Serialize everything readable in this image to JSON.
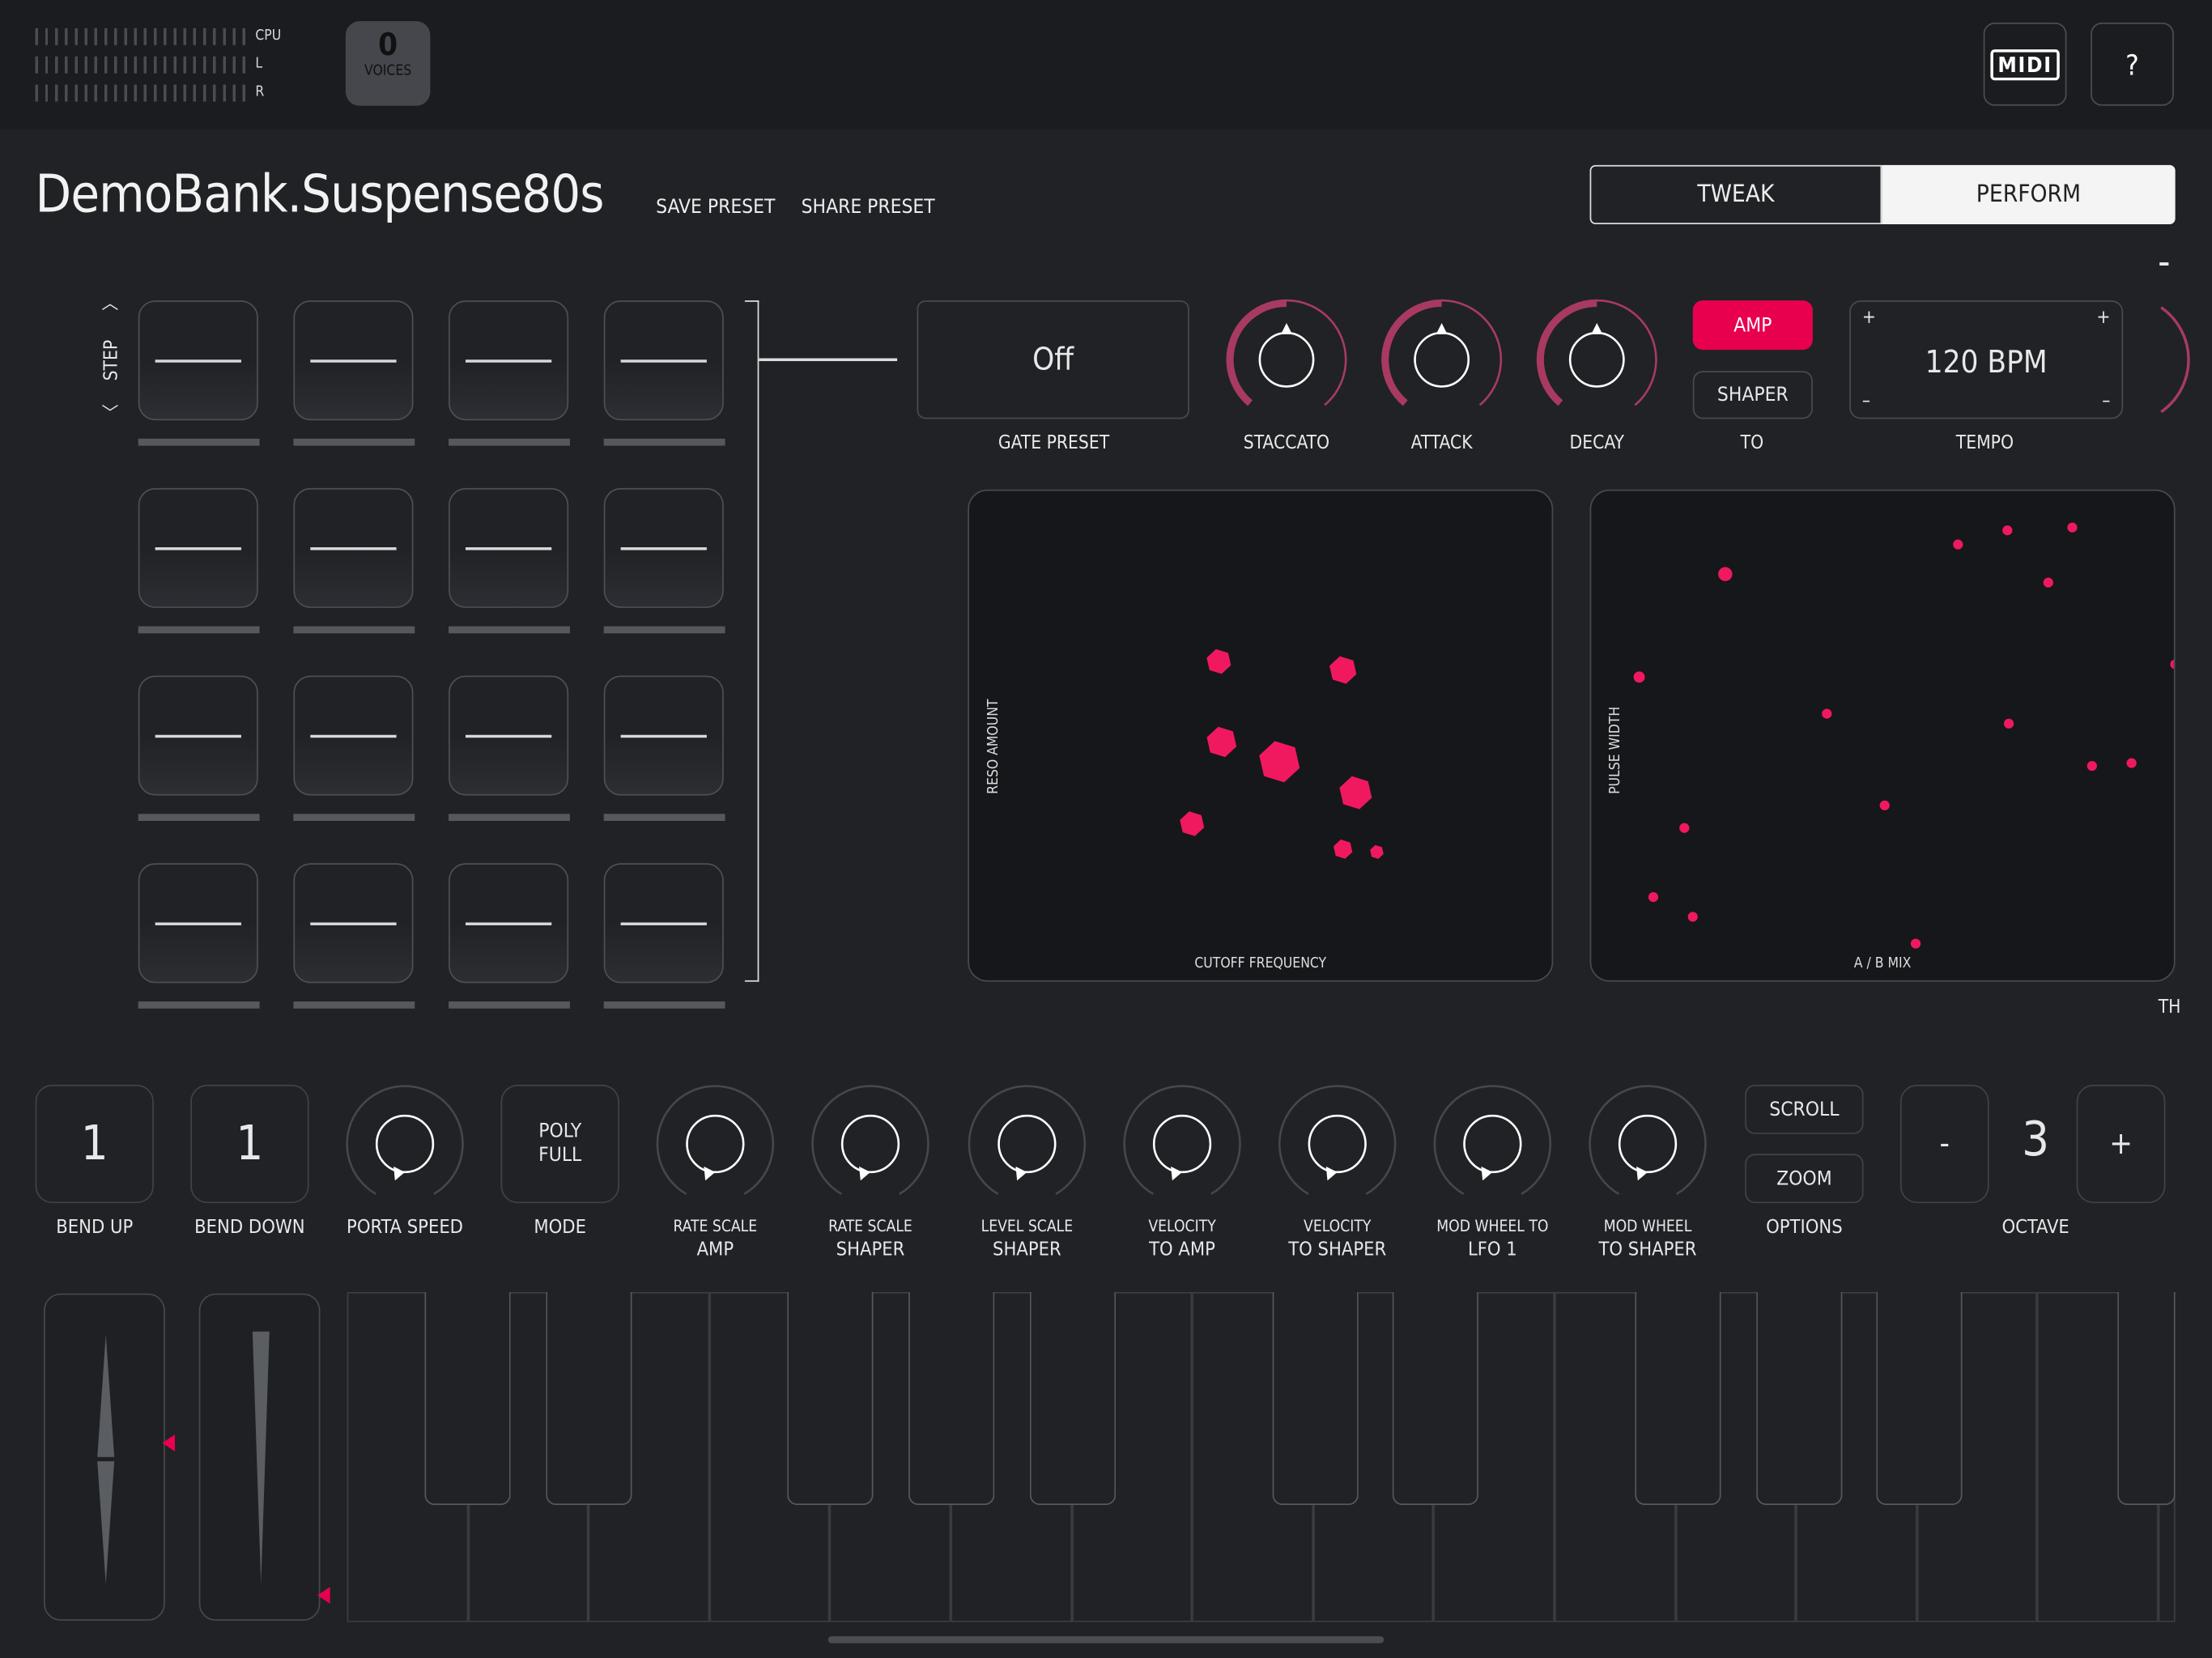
{
  "colors": {
    "accent": "#e8004f",
    "knob_arc": "#a83a62",
    "background": "#202226"
  },
  "top_bar": {
    "meters": [
      {
        "label": "CPU"
      },
      {
        "label": "L"
      },
      {
        "label": "R"
      }
    ],
    "voices": {
      "count": "0",
      "label": "VOICES"
    },
    "midi_button": {
      "label": "MIDI",
      "icon": "midi-icon"
    },
    "help_button": {
      "label": "?",
      "icon": "help-icon"
    }
  },
  "header": {
    "preset_name": "DemoBank.Suspense80s",
    "save_label": "SAVE PRESET",
    "share_label": "SHARE PRESET",
    "tabs": [
      {
        "label": "TWEAK",
        "active": false
      },
      {
        "label": "PERFORM",
        "active": true
      }
    ],
    "collapse_label": "–"
  },
  "sequencer": {
    "label": "STEP",
    "up_icon": "chevron-up-icon",
    "down_icon": "chevron-down-icon",
    "steps": 16
  },
  "gate": {
    "value": "Off",
    "label": "GATE PRESET"
  },
  "knobs": [
    {
      "label": "STACCATO",
      "value": 0.5
    },
    {
      "label": "ATTACK",
      "value": 0.5
    },
    {
      "label": "DECAY",
      "value": 0.5
    }
  ],
  "target": {
    "amp_label": "AMP",
    "shaper_label": "SHAPER",
    "label": "TO",
    "selected": "AMP"
  },
  "tempo": {
    "value": "120 BPM",
    "label": "TEMPO",
    "plus": "+",
    "minus": "–"
  },
  "pads": [
    {
      "x_label": "CUTOFF FREQUENCY",
      "y_label": "RESO AMOUNT"
    },
    {
      "x_label": "A / B MIX",
      "y_label": "PULSE WIDTH"
    }
  ],
  "edge_text": "TH",
  "controls": [
    {
      "type": "value",
      "value": "1",
      "label": "BEND UP"
    },
    {
      "type": "value",
      "value": "1",
      "label": "BEND DOWN"
    },
    {
      "type": "knob",
      "label": "PORTA SPEED"
    },
    {
      "type": "value",
      "value": "POLY FULL",
      "label": "MODE"
    },
    {
      "type": "knob",
      "label_small": "RATE SCALE",
      "label": "AMP"
    },
    {
      "type": "knob",
      "label_small": "RATE SCALE",
      "label": "SHAPER"
    },
    {
      "type": "knob",
      "label_small": "LEVEL SCALE",
      "label": "SHAPER"
    },
    {
      "type": "knob",
      "label_small": "VELOCITY",
      "label": "TO AMP"
    },
    {
      "type": "knob",
      "label_small": "VELOCITY",
      "label": "TO SHAPER"
    },
    {
      "type": "knob",
      "label_small": "MOD WHEEL TO",
      "label": "LFO 1"
    },
    {
      "type": "knob",
      "label_small": "MOD WHEEL",
      "label": "TO SHAPER"
    }
  ],
  "options": {
    "scroll_label": "SCROLL",
    "zoom_label": "ZOOM",
    "label": "OPTIONS"
  },
  "octave": {
    "minus": "-",
    "value": "3",
    "plus": "+",
    "label": "OCTAVE"
  }
}
